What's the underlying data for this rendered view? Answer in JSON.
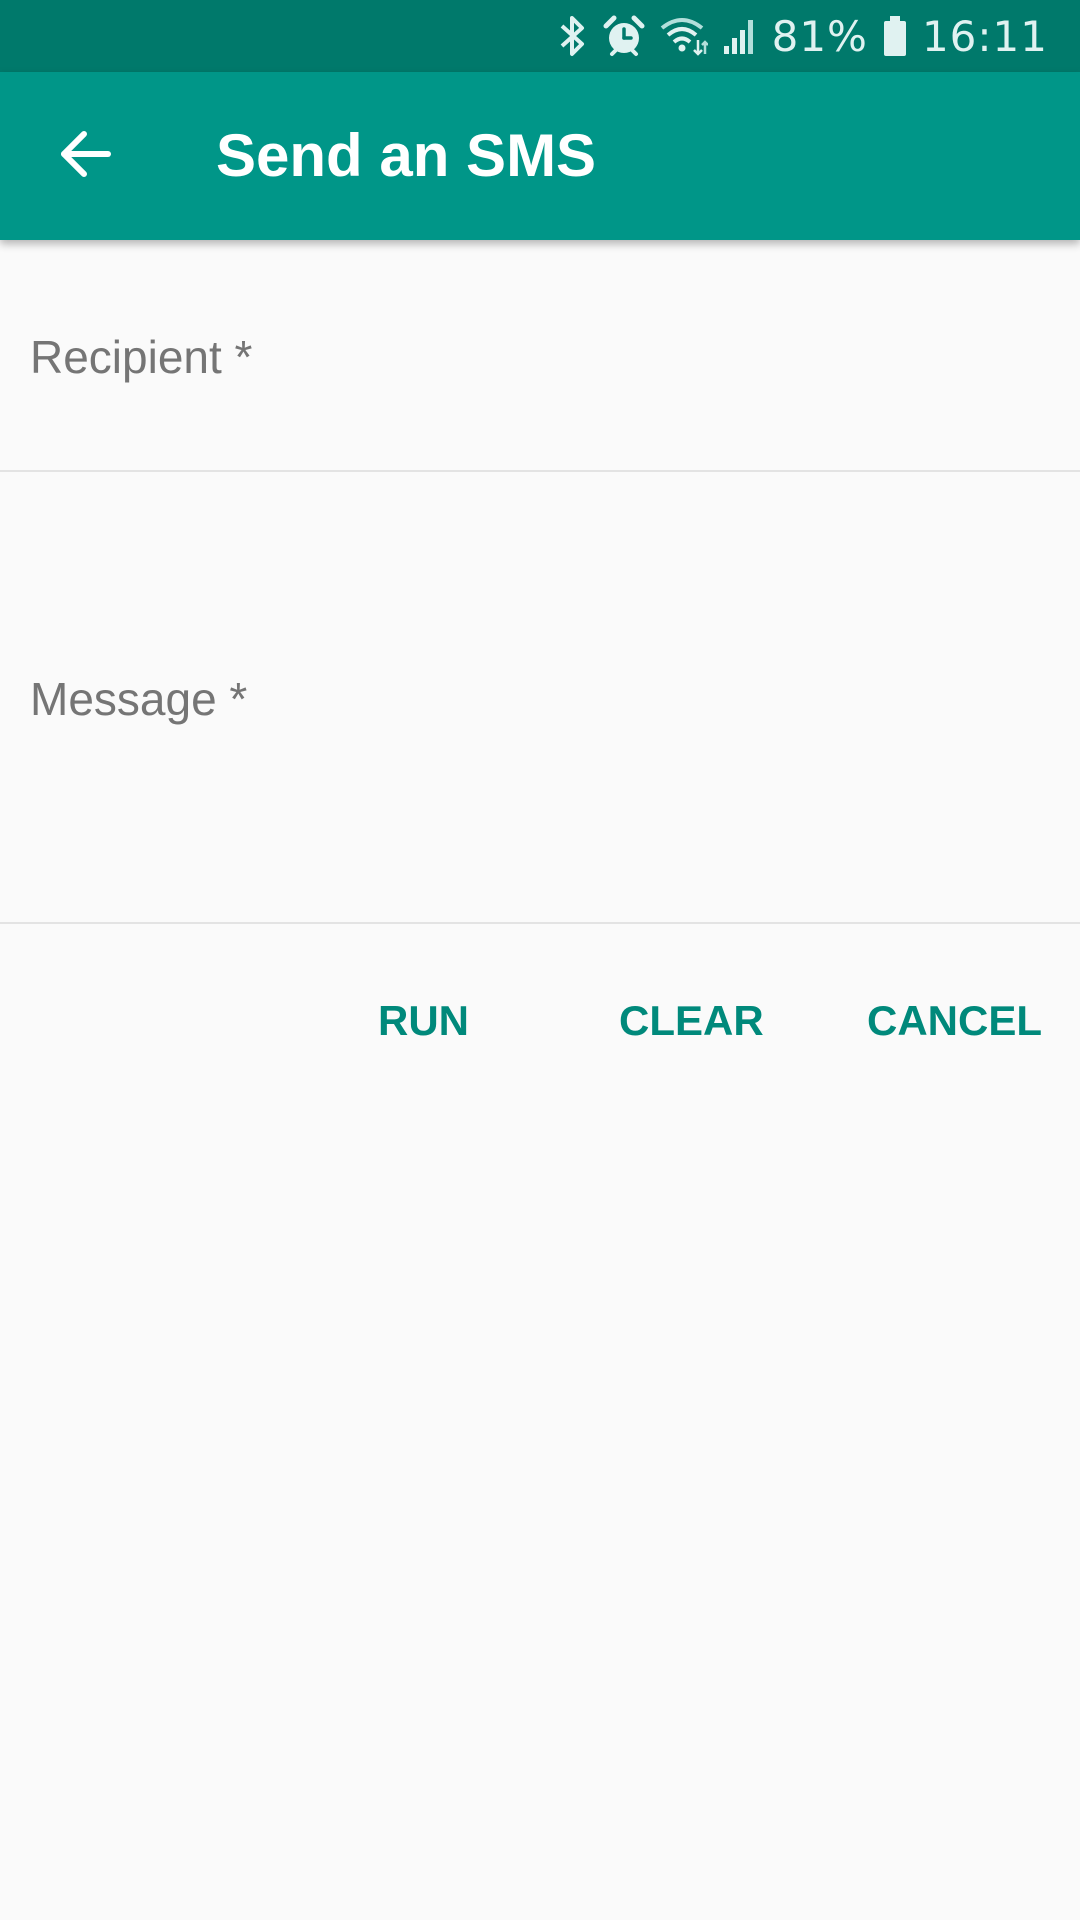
{
  "status_bar": {
    "battery_percent": "81%",
    "time": "16:11",
    "icons": [
      "bluetooth-icon",
      "alarm-icon",
      "wifi-icon",
      "signal-icon",
      "battery-icon"
    ],
    "background_color": "#00796b"
  },
  "app_bar": {
    "title": "Send an SMS",
    "back_icon": "arrow-back-icon",
    "background_color": "#009688"
  },
  "form": {
    "recipient": {
      "label": "Recipient *",
      "value": ""
    },
    "message": {
      "label": "Message *",
      "value": ""
    }
  },
  "actions": {
    "run_label": "RUN",
    "clear_label": "CLEAR",
    "cancel_label": "CANCEL",
    "accent_color": "#00897b"
  }
}
